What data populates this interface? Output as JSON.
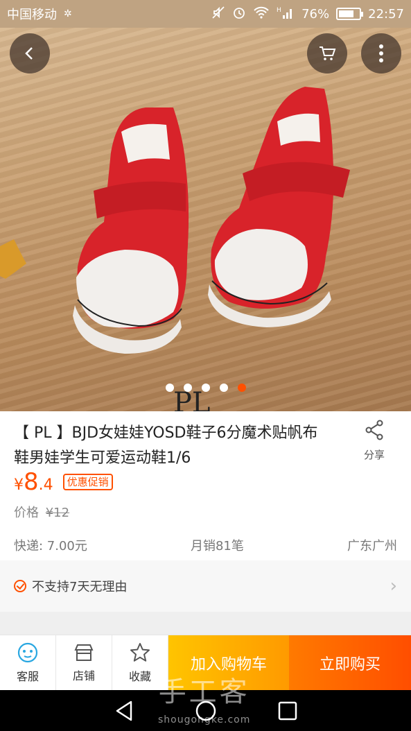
{
  "status_bar": {
    "carrier": "中国移动",
    "battery": "76%",
    "battery_level": 0.76,
    "time": "22:57"
  },
  "product": {
    "title": "【 PL 】BJD女娃娃YOSD鞋子6分魔术贴帆布鞋男娃学生可爱运动鞋1/6",
    "currency": "¥",
    "price_int": "8",
    "price_dec": ".4",
    "promo_badge": "优惠促销",
    "orig_label": "价格",
    "orig_price": "¥12",
    "shipping": "快递: 7.00元",
    "monthly_sales": "月销81笔",
    "location": "广东广州",
    "image_mark": "PL",
    "carousel": {
      "count": 5,
      "active": 5
    }
  },
  "share_label": "分享",
  "service": {
    "text": "不支持7天无理由"
  },
  "bottom_bar": {
    "service_label": "客服",
    "shop_label": "店铺",
    "fav_label": "收藏",
    "cart_label": "加入购物车",
    "buy_label": "立即购买"
  },
  "watermark": {
    "main": "手工客",
    "sub": "shougongke.com"
  },
  "colors": {
    "accent": "#ff5000",
    "cart_button": "#ffb300",
    "buy_button": "#ff5a00"
  }
}
